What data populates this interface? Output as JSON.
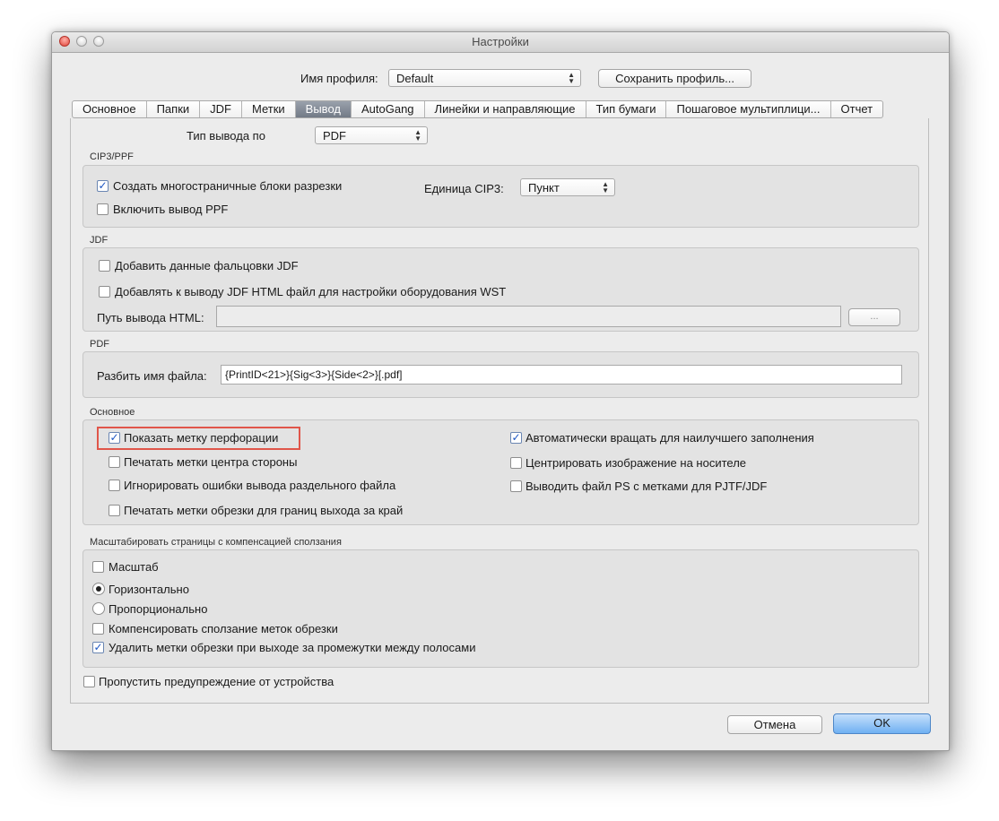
{
  "window": {
    "title": "Настройки"
  },
  "profile": {
    "label": "Имя профиля:",
    "value": "Default",
    "save_button": "Сохранить профиль..."
  },
  "tabs": [
    "Основное",
    "Папки",
    "JDF",
    "Метки",
    "Вывод",
    "AutoGang",
    "Линейки и направляющие",
    "Тип бумаги",
    "Пошаговое мультиплици...",
    "Отчет"
  ],
  "output_type": {
    "label": "Тип вывода по",
    "value": "PDF"
  },
  "cip3": {
    "title": "CIP3/PPF",
    "create_blocks": {
      "label": "Создать многостраничные блоки разрезки",
      "checked": true
    },
    "enable_ppf": {
      "label": "Включить вывод PPF",
      "checked": false
    },
    "unit": {
      "label": "Единица CIP3:",
      "value": "Пункт"
    }
  },
  "jdf": {
    "title": "JDF",
    "add_folding": {
      "label": "Добавить данные фальцовки JDF",
      "checked": false
    },
    "add_html": {
      "label": "Добавлять к выводу JDF HTML файл для настройки оборудования WST",
      "checked": false
    },
    "html_path": {
      "label": "Путь вывода HTML:",
      "value": "",
      "browse_button": "..."
    }
  },
  "pdf": {
    "title": "PDF",
    "split_name": {
      "label": "Разбить имя файла:",
      "value": "{PrintID<21>}{Sig<3>}{Side<2>}[.pdf]"
    }
  },
  "general": {
    "title": "Основное",
    "show_perf": {
      "label": "Показать метку перфорации",
      "checked": true
    },
    "print_center": {
      "label": "Печатать метки центра стороны",
      "checked": false
    },
    "ignore_errors": {
      "label": "Игнорировать ошибки вывода раздельного файла",
      "checked": false
    },
    "print_trim": {
      "label": "Печатать метки обрезки для границ выхода за край",
      "checked": false
    },
    "auto_rotate": {
      "label": "Автоматически вращать для наилучшего заполнения",
      "checked": true
    },
    "center_image": {
      "label": "Центрировать изображение на носителе",
      "checked": false
    },
    "ps_marks": {
      "label": "Выводить файл PS с метками для PJTF/JDF",
      "checked": false
    }
  },
  "scale": {
    "title": "Масштабировать страницы с компенсацией сползания",
    "scale_cb": {
      "label": "Масштаб",
      "checked": false
    },
    "horizontal": {
      "label": "Горизонтально",
      "selected": true
    },
    "proportional": {
      "label": "Пропорционально",
      "selected": false
    },
    "compensate": {
      "label": "Компенсировать сползание меток обрезки",
      "checked": false
    },
    "remove_trim": {
      "label": "Удалить метки обрезки при выходе за промежутки между полосами",
      "checked": true
    }
  },
  "skip_warning": {
    "label": "Пропустить предупреждение от устройства",
    "checked": false
  },
  "buttons": {
    "cancel": "Отмена",
    "ok": "OK"
  },
  "glyphs": {
    "check": "✓",
    "arrows": "▲\n▼"
  }
}
